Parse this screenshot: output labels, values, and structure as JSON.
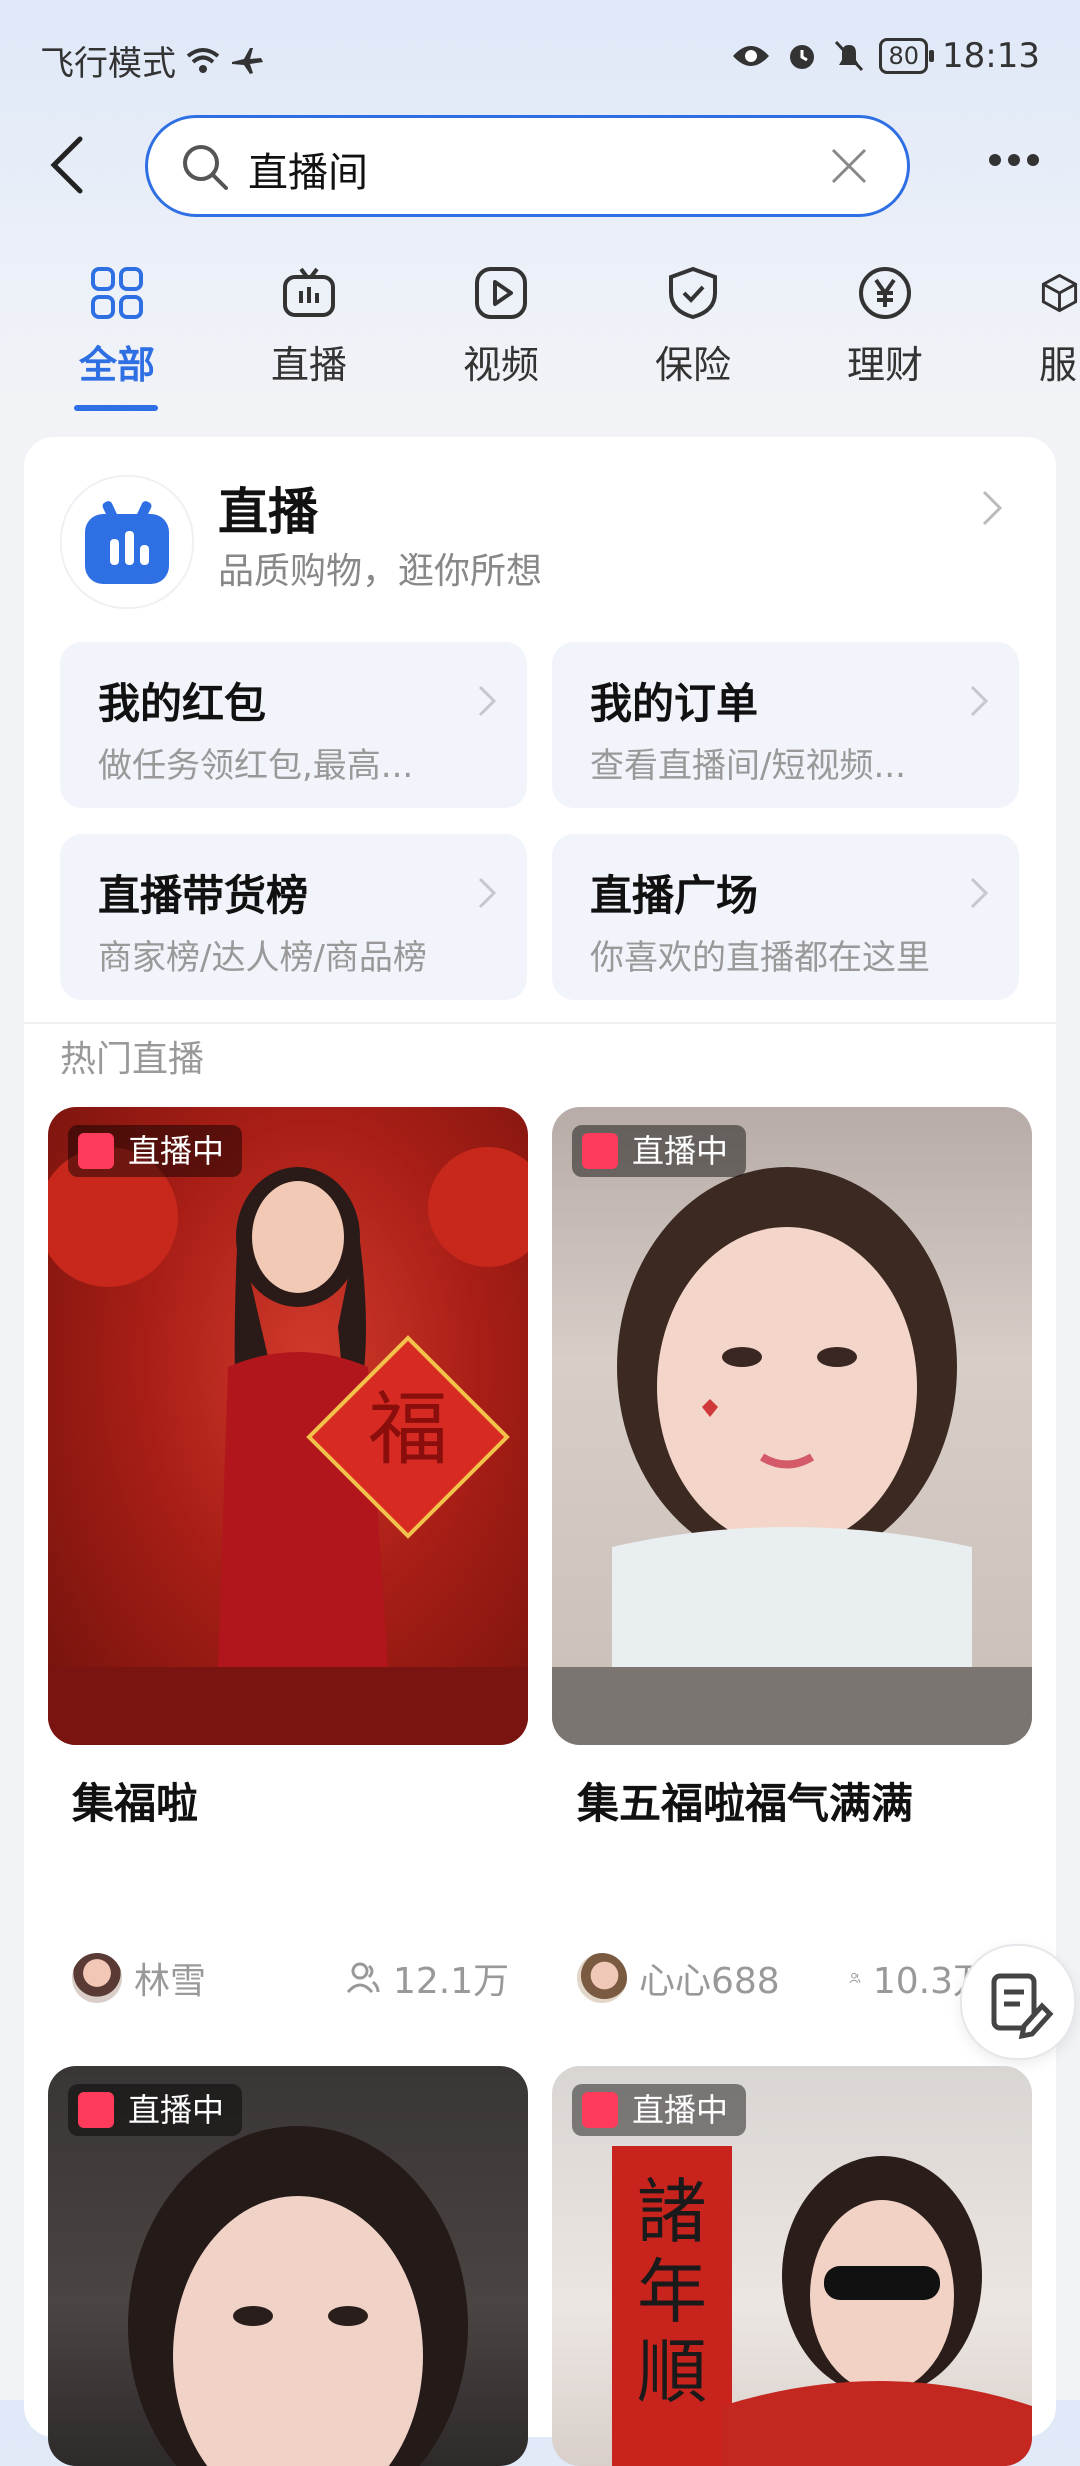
{
  "status_bar": {
    "left_text": "飞行模式",
    "battery": "80",
    "time": "18:13"
  },
  "search": {
    "query": "直播间"
  },
  "tabs": [
    {
      "label": "全部",
      "icon": "grid-icon",
      "active": true
    },
    {
      "label": "直播",
      "icon": "tv-icon"
    },
    {
      "label": "视频",
      "icon": "play-icon"
    },
    {
      "label": "保险",
      "icon": "shield-icon"
    },
    {
      "label": "理财",
      "icon": "yuan-icon"
    },
    {
      "label": "服",
      "icon": "cube-icon"
    }
  ],
  "live_service": {
    "title": "直播",
    "subtitle": "品质购物，逛你所想"
  },
  "tiles": [
    {
      "title": "我的红包",
      "subtitle": "做任务领红包,最高..."
    },
    {
      "title": "我的订单",
      "subtitle": "查看直播间/短视频..."
    },
    {
      "title": "直播带货榜",
      "subtitle": "商家榜/达人榜/商品榜"
    },
    {
      "title": "直播广场",
      "subtitle": "你喜欢的直播都在这里"
    }
  ],
  "section_title": "热门直播",
  "streams": [
    {
      "badge": "直播中",
      "title": "集福啦",
      "host": "林雪",
      "viewers": "12.1万"
    },
    {
      "badge": "直播中",
      "title": "集五福啦福气满满",
      "host": "心心688",
      "viewers": "10.3万"
    },
    {
      "badge": "直播中"
    },
    {
      "badge": "直播中"
    }
  ],
  "colors": {
    "accent": "#2f6fe4",
    "live_badge": "#ff3b5c"
  }
}
